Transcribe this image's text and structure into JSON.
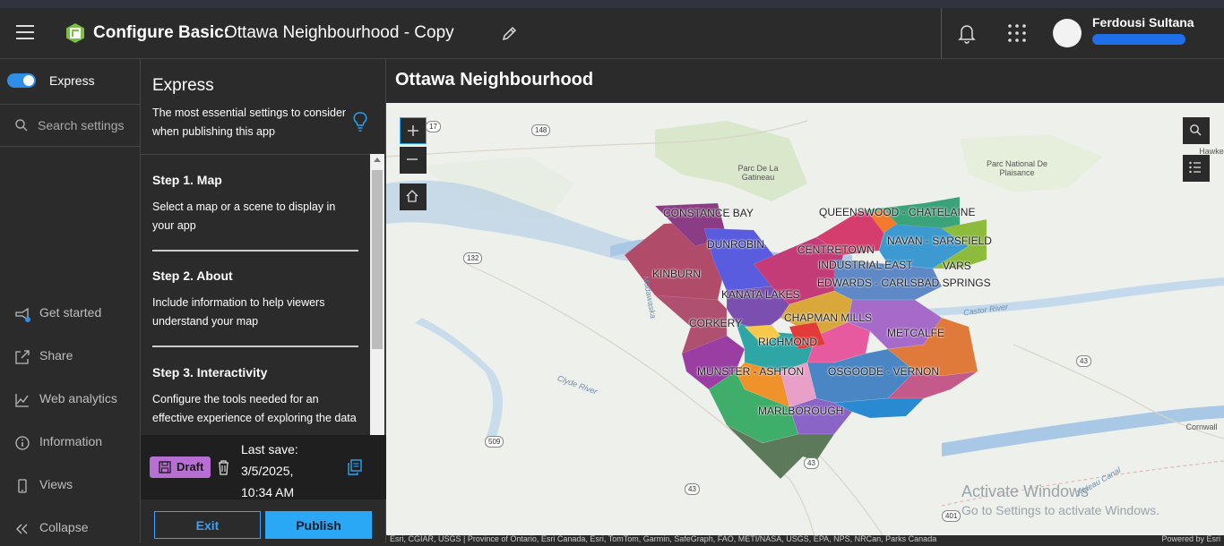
{
  "header": {
    "title_static": "Configure Basic:",
    "title_name": "Ottawa Neighbourhood - Copy",
    "username": "Ferdousi Sultana"
  },
  "leftnav": {
    "toggle_label": "Express",
    "toggle_on": true,
    "search_placeholder": "Search settings",
    "items": [
      {
        "label": "Get started",
        "icon": "megaphone-icon"
      },
      {
        "label": "Share",
        "icon": "share-icon"
      },
      {
        "label": "Web analytics",
        "icon": "analytics-icon"
      },
      {
        "label": "Information",
        "icon": "info-icon"
      },
      {
        "label": "Views",
        "icon": "device-icon"
      },
      {
        "label": "Collapse",
        "icon": "collapse-icon"
      }
    ]
  },
  "panel": {
    "title": "Express",
    "description": "The most essential settings to consider when publishing this app",
    "steps": [
      {
        "title": "Step 1. Map",
        "desc": "Select a map or a scene to display in your app"
      },
      {
        "title": "Step 2. About",
        "desc": "Include information to help viewers understand your map"
      },
      {
        "title": "Step 3. Interactivity",
        "desc": "Configure the tools needed for an effective experience of exploring the data"
      }
    ],
    "draft_label": "Draft",
    "last_save_label": "Last save:",
    "last_save_date": "3/5/2025,",
    "last_save_time": "10:34 AM",
    "exit_label": "Exit",
    "publish_label": "Publish"
  },
  "preview": {
    "title": "Ottawa Neighbourhood",
    "neighbourhoods": [
      "CONSTANCE BAY",
      "QUEENSWOOD - CHATELAINE",
      "DUNROBIN",
      "CENTRETOWN",
      "NAVAN - SARSFIELD",
      "INDUSTRIAL EAST",
      "VARS",
      "KINBURN",
      "EDWARDS - CARLSBAD SPRINGS",
      "KANATA LAKES",
      "CHAPMAN MILLS",
      "CORKERY",
      "RICHMOND",
      "METCALFE",
      "MUNSTER - ASHTON",
      "OSGOODE - VERNON",
      "MARLBOROUGH"
    ],
    "places": [
      "Parc De La Gatineau",
      "Parc National De Plaisance",
      "Hawke",
      "Cornwall"
    ],
    "rivers": [
      "Madawaska",
      "Castor River",
      "Clyde River",
      "Rideau Canal"
    ],
    "shields": [
      "17",
      "148",
      "132",
      "43",
      "509",
      "43",
      "43",
      "401"
    ],
    "attribution": "Esri, CGIAR, USGS | Province of Ontario, Esri Canada, Esri, TomTom, Garmin, SafeGraph, FAO, METI/NASA, USGS, EPA, NPS, NRCan, Parks Canada",
    "powered_by": "Powered by Esri",
    "watermark_line1": "Activate Windows",
    "watermark_line2": "Go to Settings to activate Windows."
  },
  "colors": {
    "accent": "#2aa7f5",
    "draft": "#b86fd4",
    "toggle": "#2f8ee5",
    "logo": "#7ac143"
  }
}
